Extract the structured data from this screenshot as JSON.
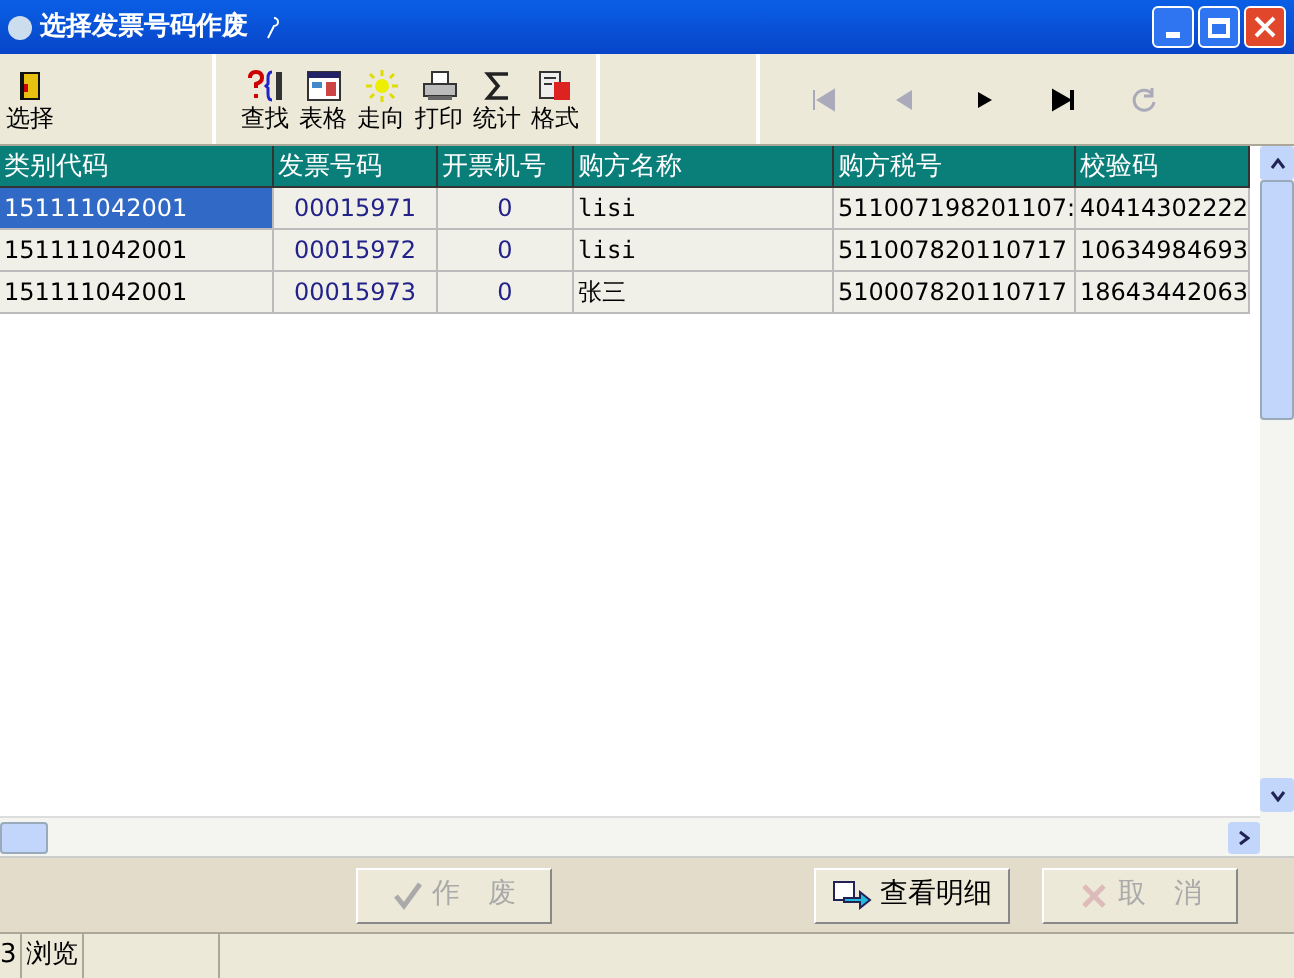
{
  "window": {
    "title": "选择发票号码作废"
  },
  "toolbar": {
    "select_button": "选择",
    "tools": [
      {
        "label": "查找",
        "kind": "find"
      },
      {
        "label": "表格",
        "kind": "table"
      },
      {
        "label": "走向",
        "kind": "direction"
      },
      {
        "label": "打印",
        "kind": "print"
      },
      {
        "label": "统计",
        "kind": "sum"
      },
      {
        "label": "格式",
        "kind": "format"
      }
    ],
    "nav": [
      {
        "kind": "first",
        "disabled": true
      },
      {
        "kind": "prev",
        "disabled": true
      },
      {
        "kind": "next",
        "disabled": false
      },
      {
        "kind": "last",
        "disabled": false
      },
      {
        "kind": "refresh",
        "disabled": true
      }
    ]
  },
  "table": {
    "columns": [
      "类别代码",
      "发票号码",
      "开票机号",
      "购方名称",
      "购方税号",
      "校验码"
    ],
    "rows": [
      {
        "selected": true,
        "cells": [
          "151111042001",
          "00015971",
          "0",
          "lisi",
          "511007198201107:",
          "40414302222"
        ]
      },
      {
        "selected": false,
        "cells": [
          "151111042001",
          "00015972",
          "0",
          "lisi",
          "511007820110717",
          "10634984693"
        ]
      },
      {
        "selected": false,
        "cells": [
          "151111042001",
          "00015973",
          "0",
          "张三",
          "510007820110717",
          "18643442063"
        ]
      }
    ]
  },
  "buttons": [
    {
      "label": "作　废",
      "kind": "void",
      "disabled": true
    },
    {
      "label": "查看明细",
      "kind": "detail",
      "disabled": false
    },
    {
      "label": "取　消",
      "kind": "cancel",
      "disabled": true
    }
  ],
  "status_bar": {
    "count": "3",
    "mode": "浏览"
  }
}
